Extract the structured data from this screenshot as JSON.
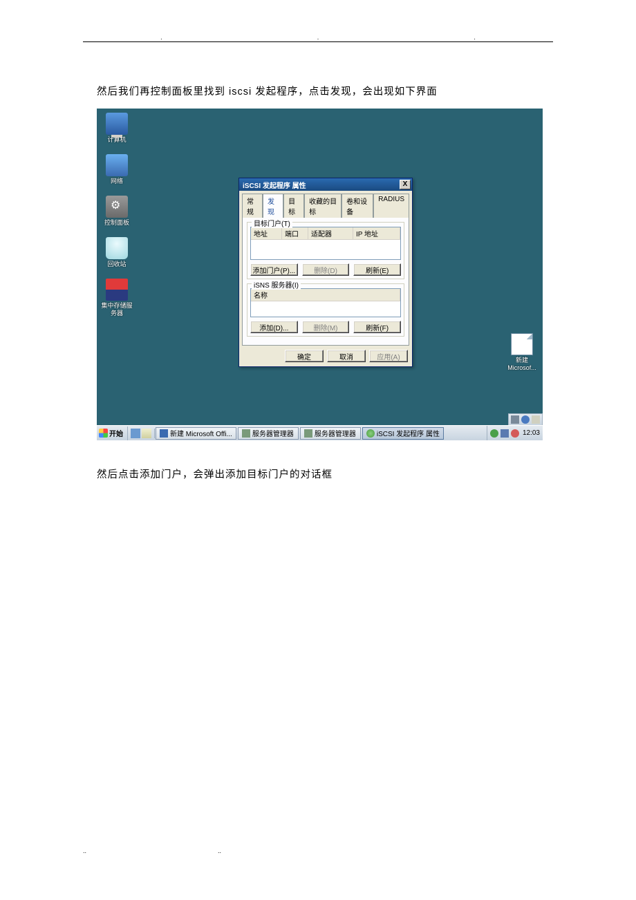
{
  "document": {
    "para1": "然后我们再控制面板里找到 iscsi 发起程序，点击发现，会出现如下界面",
    "para2": "然后点击添加门户，会弹出添加目标门户的对话框",
    "header_dot": ".",
    "footer_dot": ".."
  },
  "desktop_icons": {
    "computer": "计算机",
    "network": "网络",
    "control_panel": "控制面板",
    "recycle_bin": "回收站",
    "storage_server": "集中存储服务器",
    "new_file": "新建 Microsof..."
  },
  "dialog": {
    "title": "iSCSI 发起程序 属性",
    "close": "X",
    "tabs": {
      "general": "常规",
      "discovery": "发现",
      "targets": "目标",
      "favorites": "收藏的目标",
      "volumes": "卷和设备",
      "radius": "RADIUS"
    },
    "portals_group": {
      "legend": "目标门户(T)",
      "cols": {
        "addr": "地址",
        "port": "端口",
        "adapter": "适配器",
        "ip": "IP 地址"
      },
      "buttons": {
        "add": "添加门户(P)...",
        "remove": "删除(D)",
        "refresh": "刷新(E)"
      }
    },
    "isns_group": {
      "legend": "iSNS 服务器(I)",
      "cols": {
        "name": "名称"
      },
      "buttons": {
        "add": "添加(D)...",
        "remove": "删除(M)",
        "refresh": "刷新(F)"
      }
    },
    "footer_buttons": {
      "ok": "确定",
      "cancel": "取消",
      "apply": "应用(A)"
    }
  },
  "taskbar": {
    "start": "开始",
    "items": {
      "word": "新建 Microsoft Offi...",
      "servermgr1": "服务器管理器",
      "servermgr2": "服务器管理器",
      "iscsi": "iSCSI 发起程序 属性"
    },
    "clock": "12:03"
  }
}
